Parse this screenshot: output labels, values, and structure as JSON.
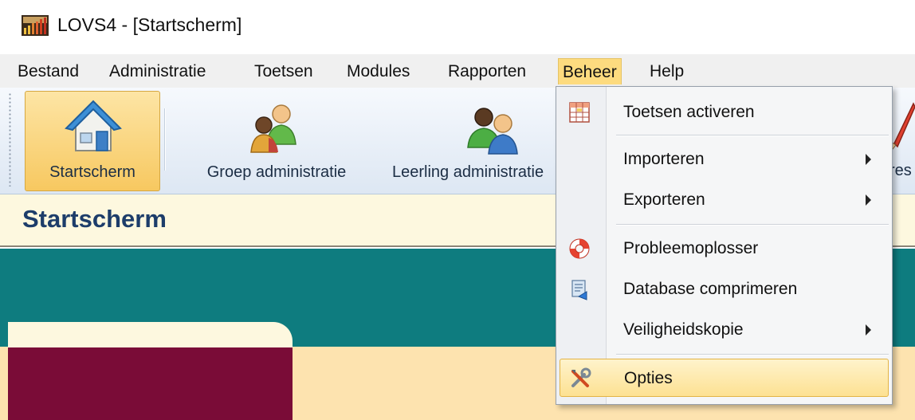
{
  "window": {
    "title": "LOVS4 - [Startscherm]",
    "app_icon": "bar-chart-app-icon"
  },
  "menubar": {
    "items": [
      {
        "label": "Bestand"
      },
      {
        "label": "Administratie"
      },
      {
        "label": "Toetsen"
      },
      {
        "label": "Modules"
      },
      {
        "label": "Rapporten"
      },
      {
        "label": "Beheer",
        "active": true
      },
      {
        "label": "Help"
      }
    ]
  },
  "toolbar": {
    "buttons": [
      {
        "label": "Startscherm",
        "icon": "home-icon",
        "selected": true
      },
      {
        "label": "Groep administratie",
        "icon": "group-users-icon"
      },
      {
        "label": "Leerling administratie",
        "icon": "student-users-icon"
      }
    ],
    "partial_label": "res"
  },
  "header": {
    "title": "Startscherm"
  },
  "beheer_menu": {
    "items": [
      {
        "label": "Toetsen activeren",
        "icon": "grid-table-icon"
      },
      {
        "label": "Importeren",
        "submenu": true
      },
      {
        "label": "Exporteren",
        "submenu": true
      },
      {
        "label": "Probleemoplosser",
        "icon": "lifebuoy-icon"
      },
      {
        "label": "Database comprimeren",
        "icon": "database-compress-icon"
      },
      {
        "label": "Veiligheidskopie",
        "submenu": true
      },
      {
        "label": "Opties",
        "icon": "tools-icon",
        "highlighted": true
      }
    ]
  },
  "colors": {
    "teal": "#0e7c7f",
    "maroon": "#7a0c37",
    "beige": "#fde3af",
    "header_bg": "#fdf8df",
    "highlight": "#fddb7f",
    "header_text": "#1d3d6a"
  }
}
